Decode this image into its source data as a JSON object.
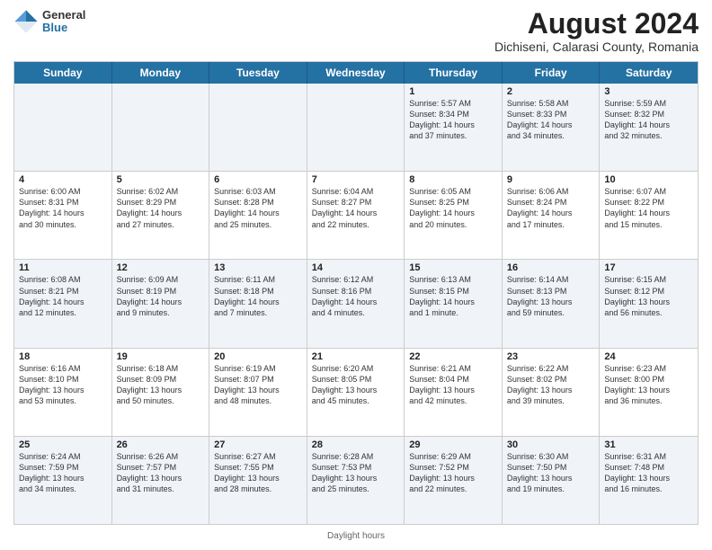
{
  "logo": {
    "line1": "General",
    "line2": "Blue"
  },
  "title": "August 2024",
  "subtitle": "Dichiseni, Calarasi County, Romania",
  "weekdays": [
    "Sunday",
    "Monday",
    "Tuesday",
    "Wednesday",
    "Thursday",
    "Friday",
    "Saturday"
  ],
  "footer": {
    "daylight_label": "Daylight hours"
  },
  "rows": [
    [
      {
        "day": "",
        "info": ""
      },
      {
        "day": "",
        "info": ""
      },
      {
        "day": "",
        "info": ""
      },
      {
        "day": "",
        "info": ""
      },
      {
        "day": "1",
        "info": "Sunrise: 5:57 AM\nSunset: 8:34 PM\nDaylight: 14 hours\nand 37 minutes."
      },
      {
        "day": "2",
        "info": "Sunrise: 5:58 AM\nSunset: 8:33 PM\nDaylight: 14 hours\nand 34 minutes."
      },
      {
        "day": "3",
        "info": "Sunrise: 5:59 AM\nSunset: 8:32 PM\nDaylight: 14 hours\nand 32 minutes."
      }
    ],
    [
      {
        "day": "4",
        "info": "Sunrise: 6:00 AM\nSunset: 8:31 PM\nDaylight: 14 hours\nand 30 minutes."
      },
      {
        "day": "5",
        "info": "Sunrise: 6:02 AM\nSunset: 8:29 PM\nDaylight: 14 hours\nand 27 minutes."
      },
      {
        "day": "6",
        "info": "Sunrise: 6:03 AM\nSunset: 8:28 PM\nDaylight: 14 hours\nand 25 minutes."
      },
      {
        "day": "7",
        "info": "Sunrise: 6:04 AM\nSunset: 8:27 PM\nDaylight: 14 hours\nand 22 minutes."
      },
      {
        "day": "8",
        "info": "Sunrise: 6:05 AM\nSunset: 8:25 PM\nDaylight: 14 hours\nand 20 minutes."
      },
      {
        "day": "9",
        "info": "Sunrise: 6:06 AM\nSunset: 8:24 PM\nDaylight: 14 hours\nand 17 minutes."
      },
      {
        "day": "10",
        "info": "Sunrise: 6:07 AM\nSunset: 8:22 PM\nDaylight: 14 hours\nand 15 minutes."
      }
    ],
    [
      {
        "day": "11",
        "info": "Sunrise: 6:08 AM\nSunset: 8:21 PM\nDaylight: 14 hours\nand 12 minutes."
      },
      {
        "day": "12",
        "info": "Sunrise: 6:09 AM\nSunset: 8:19 PM\nDaylight: 14 hours\nand 9 minutes."
      },
      {
        "day": "13",
        "info": "Sunrise: 6:11 AM\nSunset: 8:18 PM\nDaylight: 14 hours\nand 7 minutes."
      },
      {
        "day": "14",
        "info": "Sunrise: 6:12 AM\nSunset: 8:16 PM\nDaylight: 14 hours\nand 4 minutes."
      },
      {
        "day": "15",
        "info": "Sunrise: 6:13 AM\nSunset: 8:15 PM\nDaylight: 14 hours\nand 1 minute."
      },
      {
        "day": "16",
        "info": "Sunrise: 6:14 AM\nSunset: 8:13 PM\nDaylight: 13 hours\nand 59 minutes."
      },
      {
        "day": "17",
        "info": "Sunrise: 6:15 AM\nSunset: 8:12 PM\nDaylight: 13 hours\nand 56 minutes."
      }
    ],
    [
      {
        "day": "18",
        "info": "Sunrise: 6:16 AM\nSunset: 8:10 PM\nDaylight: 13 hours\nand 53 minutes."
      },
      {
        "day": "19",
        "info": "Sunrise: 6:18 AM\nSunset: 8:09 PM\nDaylight: 13 hours\nand 50 minutes."
      },
      {
        "day": "20",
        "info": "Sunrise: 6:19 AM\nSunset: 8:07 PM\nDaylight: 13 hours\nand 48 minutes."
      },
      {
        "day": "21",
        "info": "Sunrise: 6:20 AM\nSunset: 8:05 PM\nDaylight: 13 hours\nand 45 minutes."
      },
      {
        "day": "22",
        "info": "Sunrise: 6:21 AM\nSunset: 8:04 PM\nDaylight: 13 hours\nand 42 minutes."
      },
      {
        "day": "23",
        "info": "Sunrise: 6:22 AM\nSunset: 8:02 PM\nDaylight: 13 hours\nand 39 minutes."
      },
      {
        "day": "24",
        "info": "Sunrise: 6:23 AM\nSunset: 8:00 PM\nDaylight: 13 hours\nand 36 minutes."
      }
    ],
    [
      {
        "day": "25",
        "info": "Sunrise: 6:24 AM\nSunset: 7:59 PM\nDaylight: 13 hours\nand 34 minutes."
      },
      {
        "day": "26",
        "info": "Sunrise: 6:26 AM\nSunset: 7:57 PM\nDaylight: 13 hours\nand 31 minutes."
      },
      {
        "day": "27",
        "info": "Sunrise: 6:27 AM\nSunset: 7:55 PM\nDaylight: 13 hours\nand 28 minutes."
      },
      {
        "day": "28",
        "info": "Sunrise: 6:28 AM\nSunset: 7:53 PM\nDaylight: 13 hours\nand 25 minutes."
      },
      {
        "day": "29",
        "info": "Sunrise: 6:29 AM\nSunset: 7:52 PM\nDaylight: 13 hours\nand 22 minutes."
      },
      {
        "day": "30",
        "info": "Sunrise: 6:30 AM\nSunset: 7:50 PM\nDaylight: 13 hours\nand 19 minutes."
      },
      {
        "day": "31",
        "info": "Sunrise: 6:31 AM\nSunset: 7:48 PM\nDaylight: 13 hours\nand 16 minutes."
      }
    ]
  ]
}
